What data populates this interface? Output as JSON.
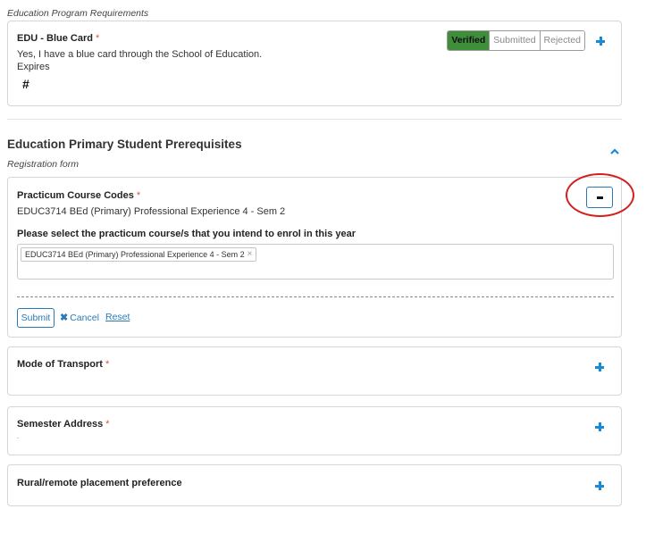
{
  "education_requirements": {
    "caption": "Education Program Requirements",
    "blue_card": {
      "title": "EDU - Blue Card",
      "required_marker": "*",
      "answer": "Yes, I have a blue card through the School of Education.",
      "expires_label": "Expires",
      "hash_symbol": "#",
      "status_options": [
        "Verified",
        "Submitted",
        "Rejected"
      ],
      "active_status": "Verified",
      "add_icon": "plus-icon"
    }
  },
  "primary_prerequisites": {
    "heading": "Education Primary Student Prerequisites",
    "subcaption": "Registration form",
    "collapse_icon": "chevron-up-icon",
    "practicum": {
      "title": "Practicum Course Codes",
      "required_marker": "*",
      "current_value": "EDUC3714 BEd (Primary) Professional Experience 4 - Sem 2",
      "select_label": "Please select the practicum course/s that you intend to enrol in this year",
      "selected_chips": [
        "EDUC3714 BEd (Primary) Professional Experience 4 - Sem 2"
      ],
      "chip_remove_glyph": "×",
      "submit_label": "Submit",
      "cancel_label": "Cancel",
      "cancel_glyph": "✖",
      "reset_label": "Reset",
      "collapse_icon": "minus-icon"
    },
    "mode_of_transport": {
      "title": "Mode of Transport",
      "required_marker": "*",
      "add_icon": "plus-icon"
    },
    "semester_address": {
      "title": "Semester Address",
      "required_marker": "*",
      "value": "-",
      "add_icon": "plus-icon"
    },
    "rural_placement": {
      "title": "Rural/remote placement preference",
      "add_icon": "plus-icon"
    }
  },
  "colors": {
    "accent_blue": "#1a8ad4",
    "verified_green": "#3e8e3a",
    "required_red": "#d9534f",
    "highlight_circle_red": "#d42020"
  }
}
